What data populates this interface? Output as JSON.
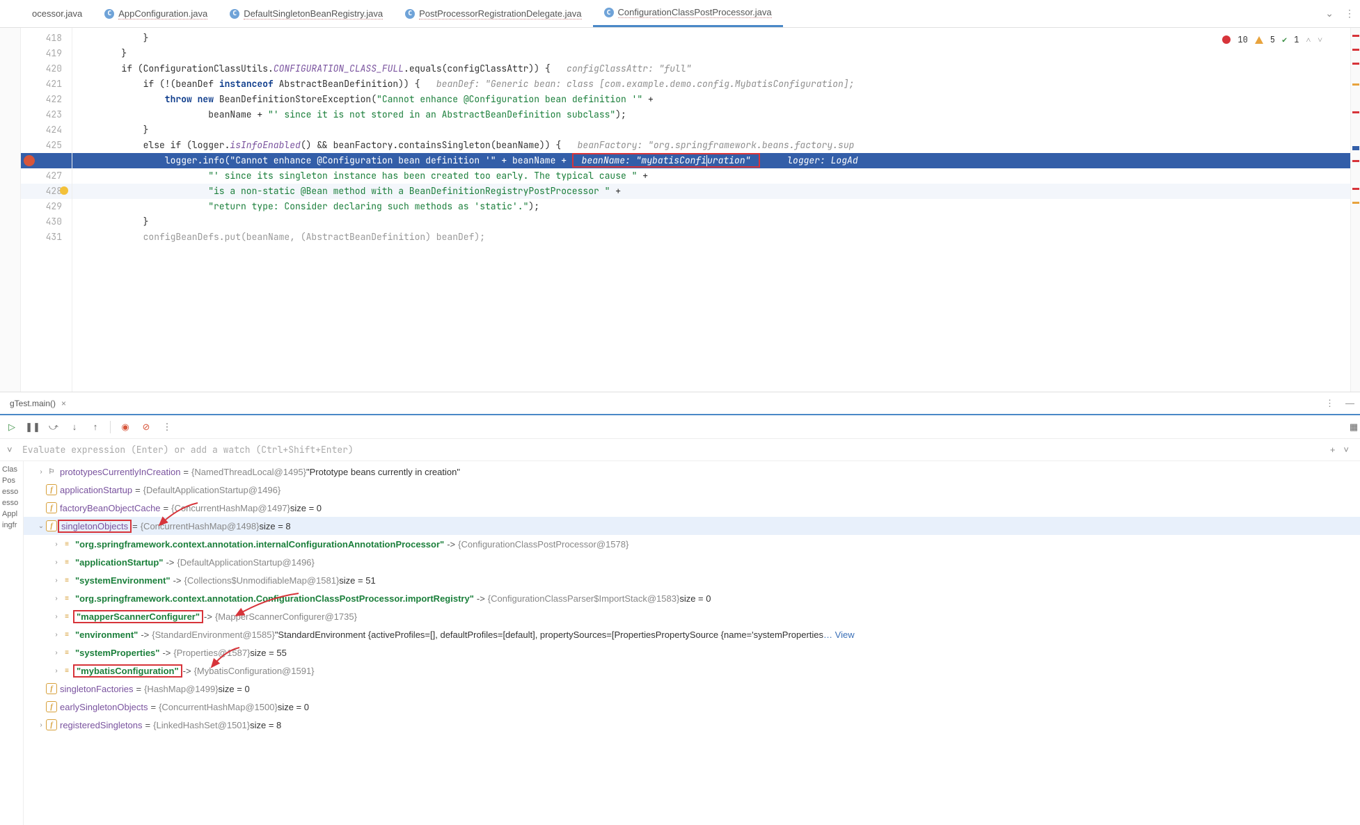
{
  "tabs": [
    {
      "label": "ocessor.java"
    },
    {
      "label": "AppConfiguration.java"
    },
    {
      "label": "DefaultSingletonBeanRegistry.java"
    },
    {
      "label": "PostProcessorRegistrationDelegate.java"
    },
    {
      "label": "ConfigurationClassPostProcessor.java",
      "active": true
    }
  ],
  "badges": {
    "errors": "10",
    "warnings": "5",
    "checks": "1"
  },
  "gutter": [
    "418",
    "419",
    "420",
    "421",
    "422",
    "423",
    "424",
    "425",
    "",
    "427",
    "428",
    "429",
    "430",
    "431"
  ],
  "code": {
    "l418": "            }",
    "l419": "        }",
    "l420a": "        if (ConfigurationClassUtils.",
    "l420b": "CONFIGURATION_CLASS_FULL",
    "l420c": ".equals(configClassAttr)) {",
    "l420h": "   configClassAttr: \"full\"",
    "l421a": "            if (!(beanDef ",
    "l421k": "instanceof",
    "l421b": " AbstractBeanDefinition)) {",
    "l421h": "   beanDef: \"Generic bean: class [com.example.demo.config.MybatisConfiguration];",
    "l422a": "                throw new ",
    "l422b": "BeanDefinitionStoreException(",
    "l422s": "\"Cannot enhance @Configuration bean definition '\"",
    "l422c": " +",
    "l423a": "                        beanName + ",
    "l423s": "\"' since it is not stored in an AbstractBeanDefinition subclass\"",
    "l423b": ");",
    "l424": "            }",
    "l425a": "            else if (logger.",
    "l425b": "isInfoEnabled",
    "l425c": "() && beanFactory.containsSingleton(beanName)) {",
    "l425h": "   beanFactory: \"org.springframework.beans.factory.sup",
    "l426a": "                logger.info(",
    "l426s": "\"Cannot enhance @Configuration bean definition '\"",
    "l426b": " + beanName + ",
    "l426box": " beanName: \"mybatisConfi",
    "l426box2": "uration\" ",
    "l426h": "     logger: LogAd",
    "l427a": "                        ",
    "l427s": "\"' since its singleton instance has been created too early. The typical cause \"",
    "l427b": " +",
    "l428a": "                        ",
    "l428s": "\"is a non-static @Bean method with a BeanDefinitionRegistryPostProcessor \"",
    "l428b": " +",
    "l429a": "                        ",
    "l429s": "\"return type: Consider declaring such methods as 'static'.\"",
    "l429b": ");",
    "l430": "            }",
    "l431": "            configBeanDefs.put(beanName, (AbstractBeanDefinition) beanDef);"
  },
  "run_tab": "gTest.main()",
  "eval_placeholder": "Evaluate expression (Enter) or add a watch (Ctrl+Shift+Enter)",
  "threads": [
    "Clas",
    "Pos",
    "esso",
    "esso",
    "Appl",
    "ingfr"
  ],
  "vars": [
    {
      "ind": 1,
      "arr": ">",
      "ic": "p",
      "name": "prototypesCurrentlyInCreation",
      "eq": " = ",
      "val": "{NamedThreadLocal@1495} ",
      "plain": "\"Prototype beans currently in creation\""
    },
    {
      "ind": 1,
      "arr": "",
      "ic": "f",
      "name": "applicationStartup",
      "eq": " = ",
      "val": "{DefaultApplicationStartup@1496}"
    },
    {
      "ind": 1,
      "arr": "",
      "ic": "f",
      "name": "factoryBeanObjectCache",
      "eq": " = ",
      "val": "{ConcurrentHashMap@1497}  ",
      "plain": "size = 0",
      "arrowStart": true
    },
    {
      "ind": 1,
      "arr": "v",
      "ic": "f",
      "name": "singletonObjects",
      "eq": " = ",
      "val": "{ConcurrentHashMap@1498}  ",
      "plain": "size = 8",
      "sel": true,
      "boxName": true
    },
    {
      "ind": 2,
      "arr": ">",
      "ic": "kv",
      "key": "\"org.springframework.context.annotation.internalConfigurationAnnotationProcessor\"",
      "eq": " -> ",
      "val": "{ConfigurationClassPostProcessor@1578}"
    },
    {
      "ind": 2,
      "arr": ">",
      "ic": "kv",
      "key": "\"applicationStartup\"",
      "eq": " -> ",
      "val": "{DefaultApplicationStartup@1496}"
    },
    {
      "ind": 2,
      "arr": ">",
      "ic": "kv",
      "key": "\"systemEnvironment\"",
      "eq": " -> ",
      "val": "{Collections$UnmodifiableMap@1581}  ",
      "plain": "size = 51"
    },
    {
      "ind": 2,
      "arr": ">",
      "ic": "kv",
      "key": "\"org.springframework.context.annotation.ConfigurationClassPostProcessor.importRegistry\"",
      "eq": " -> ",
      "val": "{ConfigurationClassParser$ImportStack@1583}  ",
      "plain": "size = 0",
      "arrow2Start": true
    },
    {
      "ind": 2,
      "arr": ">",
      "ic": "kv",
      "key": "\"mapperScannerConfigurer\"",
      "eq": " -> ",
      "val": "{MapperScannerConfigurer@1735}",
      "boxKey": true
    },
    {
      "ind": 2,
      "arr": ">",
      "ic": "kv",
      "key": "\"environment\"",
      "eq": " -> ",
      "val": "{StandardEnvironment@1585} ",
      "plain": "\"StandardEnvironment {activeProfiles=[], defaultProfiles=[default], propertySources=[PropertiesPropertySource {name='systemProperties",
      "view": true
    },
    {
      "ind": 2,
      "arr": ">",
      "ic": "kv",
      "key": "\"systemProperties\"",
      "eq": " -> ",
      "val": "{Properties@1587}  ",
      "plain": "size = 55",
      "arrow3Start": true
    },
    {
      "ind": 2,
      "arr": ">",
      "ic": "kv",
      "key": "\"mybatisConfiguration\"",
      "eq": " -> ",
      "val": "{MybatisConfiguration@1591}",
      "boxKey": true
    },
    {
      "ind": 1,
      "arr": "",
      "ic": "f",
      "name": "singletonFactories",
      "eq": " = ",
      "val": "{HashMap@1499}  ",
      "plain": "size = 0"
    },
    {
      "ind": 1,
      "arr": "",
      "ic": "f",
      "name": "earlySingletonObjects",
      "eq": " = ",
      "val": "{ConcurrentHashMap@1500}  ",
      "plain": "size = 0"
    },
    {
      "ind": 1,
      "arr": ">",
      "ic": "f",
      "name": "registeredSingletons",
      "eq": " = ",
      "val": "{LinkedHashSet@1501}  ",
      "plain": "size = 8"
    }
  ],
  "view_label": "… View"
}
